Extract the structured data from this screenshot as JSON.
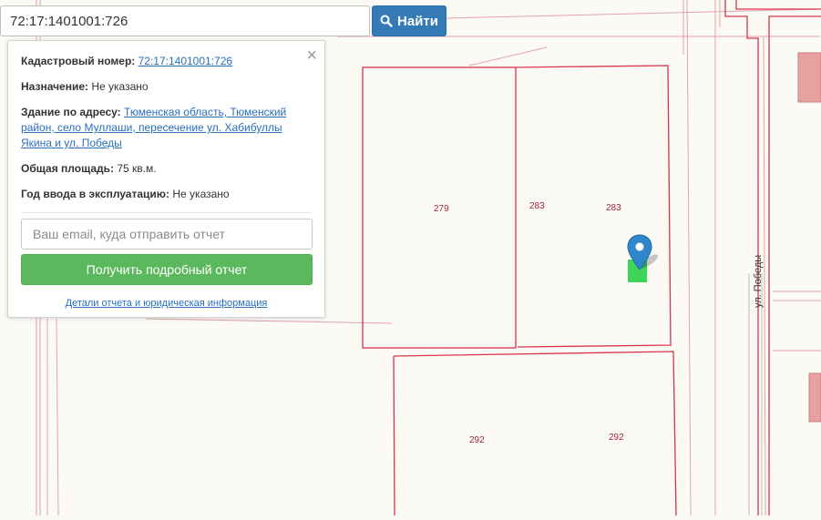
{
  "search": {
    "value": "72:17:1401001:726",
    "button_label": "Найти"
  },
  "popup": {
    "close_glyph": "×",
    "cadastral_label": "Кадастровый номер:",
    "cadastral_value": "72:17:1401001:726",
    "purpose_label": "Назначение:",
    "purpose_value": "Не указано",
    "address_label": "Здание по адресу:",
    "address_value": "Тюменская область, Тюменский район, село Муллаши, пересечение ул. Хабибуллы Якина и ул. Победы",
    "area_label": "Общая площадь:",
    "area_value": "75 кв.м.",
    "year_label": "Год ввода в эксплуатацию:",
    "year_value": "Не указано",
    "email_placeholder": "Ваш email, куда отправить отчет",
    "report_button": "Получить подробный отчет",
    "details_link": "Детали отчета и юридическая информация"
  },
  "map": {
    "parcel_labels": [
      "279",
      "283",
      "283",
      "292",
      "292"
    ],
    "street_label": "ул. Победы",
    "colors": {
      "background": "#fbfaf5",
      "boundary": "#d9344a",
      "building_fill": "#e8a1a1",
      "selected_building": "#3ed45a",
      "marker": "#2f86c9"
    }
  }
}
